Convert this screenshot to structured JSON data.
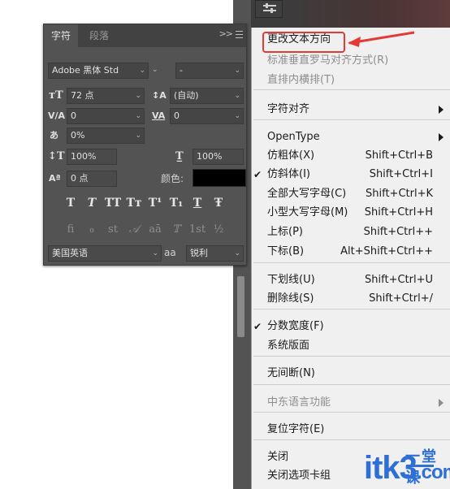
{
  "char_panel": {
    "tabs": [
      {
        "label": "字符",
        "active": true
      },
      {
        "label": "段落",
        "active": false
      }
    ],
    "menu_btn": ">>",
    "font_family": "Adobe 黑体 Std",
    "font_style": "-",
    "font_size": "72 点",
    "leading": "(自动)",
    "kerning": "0",
    "tracking": "0",
    "tsume": "0%",
    "vertical_scale": "100%",
    "horizontal_scale": "100%",
    "baseline_shift": "0 点",
    "color_label": "颜色:",
    "color_value": "#000000",
    "style_buttons": [
      "T",
      "T",
      "TT",
      "Tт",
      "T¹",
      "T₁",
      "T",
      "Ŧ"
    ],
    "opentype_buttons": [
      "ﬁ",
      "ℴ",
      "st",
      "𝒜",
      "aā",
      "𝕋",
      "1st",
      "½"
    ],
    "language": "美国英语",
    "antialias_icon": "aa",
    "antialias": "锐利"
  },
  "context_menu": {
    "items": [
      {
        "label": "更改文本方向",
        "shortcut": "",
        "disabled": false,
        "checked": false,
        "submenu": false
      },
      {
        "label": "标准垂直罗马对齐方式(R)",
        "shortcut": "",
        "disabled": true,
        "checked": false,
        "submenu": false
      },
      {
        "label": "直排内横排(T)",
        "shortcut": "",
        "disabled": true,
        "checked": false,
        "submenu": false
      },
      {
        "label": "字符对齐",
        "shortcut": "",
        "disabled": false,
        "checked": false,
        "submenu": true
      },
      {
        "label": "OpenType",
        "shortcut": "",
        "disabled": false,
        "checked": false,
        "submenu": true
      },
      {
        "label": "仿粗体(X)",
        "shortcut": "Shift+Ctrl+B",
        "disabled": false,
        "checked": false,
        "submenu": false
      },
      {
        "label": "仿斜体(I)",
        "shortcut": "Shift+Ctrl+I",
        "disabled": false,
        "checked": true,
        "submenu": false
      },
      {
        "label": "全部大写字母(C)",
        "shortcut": "Shift+Ctrl+K",
        "disabled": false,
        "checked": false,
        "submenu": false
      },
      {
        "label": "小型大写字母(M)",
        "shortcut": "Shift+Ctrl+H",
        "disabled": false,
        "checked": false,
        "submenu": false
      },
      {
        "label": "上标(P)",
        "shortcut": "Shift+Ctrl++",
        "disabled": false,
        "checked": false,
        "submenu": false
      },
      {
        "label": "下标(B)",
        "shortcut": "Alt+Shift+Ctrl++",
        "disabled": false,
        "checked": false,
        "submenu": false
      },
      {
        "label": "下划线(U)",
        "shortcut": "Shift+Ctrl+U",
        "disabled": false,
        "checked": false,
        "submenu": false
      },
      {
        "label": "删除线(S)",
        "shortcut": "Shift+Ctrl+/",
        "disabled": false,
        "checked": false,
        "submenu": false
      },
      {
        "label": "分数宽度(F)",
        "shortcut": "",
        "disabled": false,
        "checked": true,
        "submenu": false
      },
      {
        "label": "系统版面",
        "shortcut": "",
        "disabled": false,
        "checked": false,
        "submenu": false
      },
      {
        "label": "无间断(N)",
        "shortcut": "",
        "disabled": false,
        "checked": false,
        "submenu": false
      },
      {
        "label": "中东语言功能",
        "shortcut": "",
        "disabled": true,
        "checked": false,
        "submenu": true
      },
      {
        "label": "复位字符(E)",
        "shortcut": "",
        "disabled": false,
        "checked": false,
        "submenu": false
      },
      {
        "label": "关闭",
        "shortcut": "",
        "disabled": false,
        "checked": false,
        "submenu": false
      },
      {
        "label": "关闭选项卡组",
        "shortcut": "",
        "disabled": false,
        "checked": false,
        "submenu": false
      }
    ]
  },
  "watermark": {
    "text": "itk3",
    "suffix": ".com",
    "cn": "一堂课"
  },
  "colors": {
    "highlight": "#e53935",
    "panel_bg": "#535353",
    "menu_bg": "#f0f0f0",
    "watermark": "#2e6fd6"
  }
}
